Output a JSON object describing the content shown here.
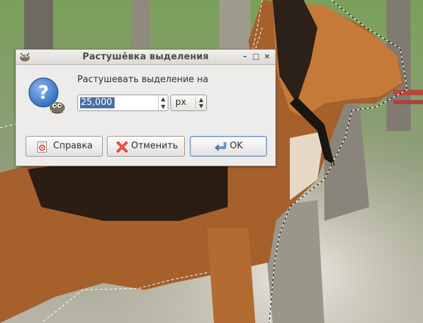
{
  "window": {
    "title": "Растушёвка выделения"
  },
  "window_controls": {
    "minimize": "–",
    "maximize": "□",
    "close": "×"
  },
  "dialog": {
    "prompt": "Растушевать выделение на",
    "radius_value": "25,000",
    "unit": "px",
    "icon": "question-icon"
  },
  "buttons": {
    "help": {
      "label": "Справка",
      "icon": "help-book-icon"
    },
    "cancel": {
      "label": "Отменить",
      "icon": "red-x-icon"
    },
    "ok": {
      "label": "OK",
      "icon": "enter-arrow-icon"
    }
  },
  "colors": {
    "selection_highlight": "#4a6fa5",
    "dialog_bg": "#edeceb",
    "ok_focus_border": "#6e8fbf",
    "cancel_icon": "#d9342b",
    "question_icon": "#2f6fc1"
  }
}
